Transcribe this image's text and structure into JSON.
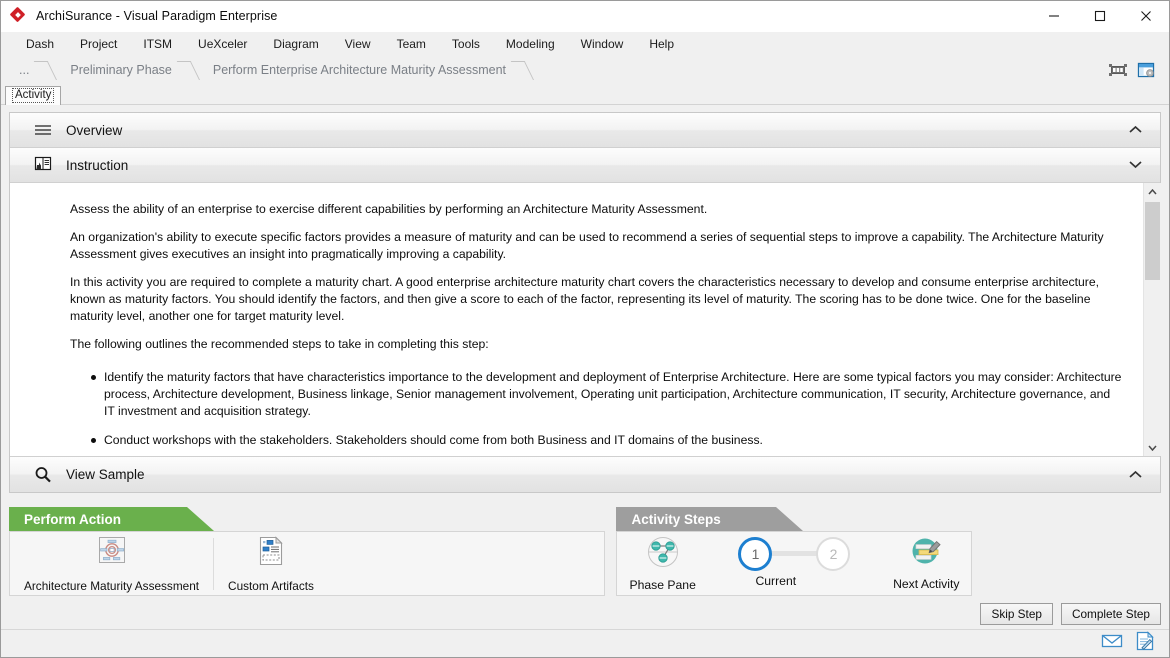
{
  "window": {
    "title": "ArchiSurance - Visual Paradigm Enterprise",
    "logo_icon": "red-diamond-logo-icon",
    "minimize_icon": "minimize-icon",
    "maximize_icon": "maximize-icon",
    "close_icon": "close-icon"
  },
  "menubar": {
    "items": [
      {
        "label": "Dash"
      },
      {
        "label": "Project"
      },
      {
        "label": "ITSM"
      },
      {
        "label": "UeXceler"
      },
      {
        "label": "Diagram"
      },
      {
        "label": "View"
      },
      {
        "label": "Team"
      },
      {
        "label": "Tools"
      },
      {
        "label": "Modeling"
      },
      {
        "label": "Window"
      },
      {
        "label": "Help"
      }
    ]
  },
  "breadcrumb": {
    "items": [
      {
        "label": "..."
      },
      {
        "label": "Preliminary Phase"
      },
      {
        "label": "Perform Enterprise Architecture Maturity Assessment"
      }
    ],
    "tool_icons": [
      {
        "name": "fit-to-window-icon"
      },
      {
        "name": "open-panel-icon"
      }
    ]
  },
  "tabstrip": {
    "tabs": [
      {
        "label": "Activity",
        "selected": true
      }
    ]
  },
  "sections": {
    "overview": {
      "title": "Overview",
      "icon": "hamburger-lines-icon",
      "expanded": false,
      "chevron": "chevron-up"
    },
    "instruction": {
      "title": "Instruction",
      "icon": "instruction-book-icon",
      "expanded": true,
      "chevron": "chevron-down",
      "paragraphs": [
        "Assess the ability of an enterprise to exercise different capabilities by performing an Architecture Maturity Assessment.",
        "An organization's ability to execute specific factors provides a measure of maturity and can be used to recommend a series of sequential steps to improve a capability. The Architecture Maturity Assessment gives executives an insight into pragmatically improving a capability.",
        "In this activity you are required to complete a maturity chart. A good enterprise architecture maturity chart covers the characteristics necessary to develop and consume enterprise architecture, known as maturity factors. You should identify the factors, and then give a score to each of the factor, representing its level of maturity. The scoring has to be done twice. One for the baseline maturity level, another one for target maturity level.",
        "The following outlines the recommended steps to take in completing this step:"
      ],
      "bullets": [
        "Identify the maturity factors that have characteristics importance to the development and deployment of Enterprise Architecture. Here are some typical factors you may consider: Architecture process, Architecture development, Business linkage, Senior management involvement, Operating unit participation, Architecture communication, IT security, Architecture governance, and IT investment and acquisition strategy.",
        "Conduct workshops with the stakeholders. Stakeholders should come from both Business and IT domains of the business."
      ]
    },
    "view_sample": {
      "title": "View Sample",
      "icon": "magnifier-icon",
      "expanded": false,
      "chevron": "chevron-up"
    }
  },
  "perform_action": {
    "title": "Perform Action",
    "accent_color": "#6ab04c",
    "items": [
      {
        "label": "Architecture Maturity Assessment",
        "icon": "maturity-chart-icon"
      },
      {
        "label": "Custom Artifacts",
        "icon": "custom-artifacts-document-icon"
      }
    ]
  },
  "activity_steps": {
    "title": "Activity Steps",
    "accent_color": "#9e9e9e",
    "phase_pane": {
      "label": "Phase Pane",
      "icon": "phase-pane-nodes-icon"
    },
    "progress": {
      "current_label": "Current",
      "steps": [
        {
          "number": "1",
          "state": "active"
        },
        {
          "number": "2",
          "state": "inactive"
        }
      ],
      "active_color": "#1d7fd0",
      "inactive_color": "#dcdcdc"
    },
    "next_activity": {
      "label": "Next Activity",
      "icon": "next-activity-edit-icon"
    },
    "buttons": [
      {
        "label": "Skip Step"
      },
      {
        "label": "Complete Step"
      }
    ]
  },
  "statusbar": {
    "icons": [
      {
        "name": "mail-envelope-icon"
      },
      {
        "name": "note-edit-icon"
      }
    ]
  }
}
